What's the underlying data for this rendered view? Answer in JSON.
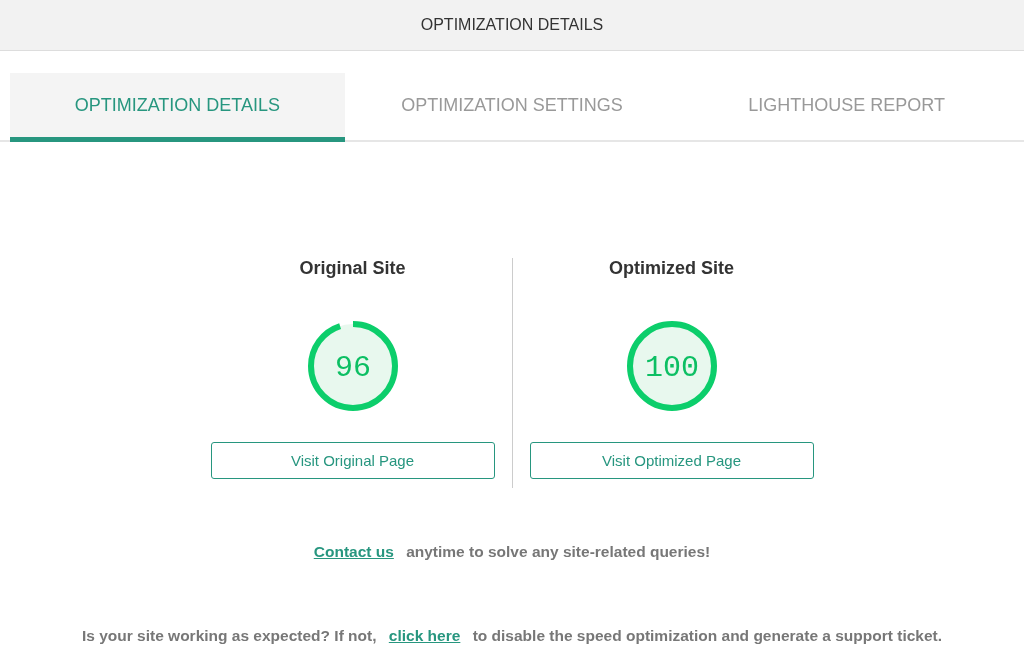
{
  "header": {
    "title": "OPTIMIZATION DETAILS"
  },
  "tabs": [
    {
      "label": "OPTIMIZATION DETAILS",
      "selected": true
    },
    {
      "label": "OPTIMIZATION SETTINGS",
      "selected": false
    },
    {
      "label": "LIGHTHOUSE REPORT",
      "selected": false
    }
  ],
  "sites": [
    {
      "title": "Original Site",
      "score": "96",
      "level": 0.96,
      "button": "Visit Original Page"
    },
    {
      "title": "Optimized Site",
      "score": "100",
      "level": 1,
      "button": "Visit Optimized Page"
    }
  ],
  "contact": {
    "link": "Contact us",
    "text": "anytime to solve any site-related queries!"
  },
  "support": {
    "before": "Is your site working as expected? If not,",
    "link": "click here",
    "after": "to disable the speed optimization and generate a support ticket."
  }
}
